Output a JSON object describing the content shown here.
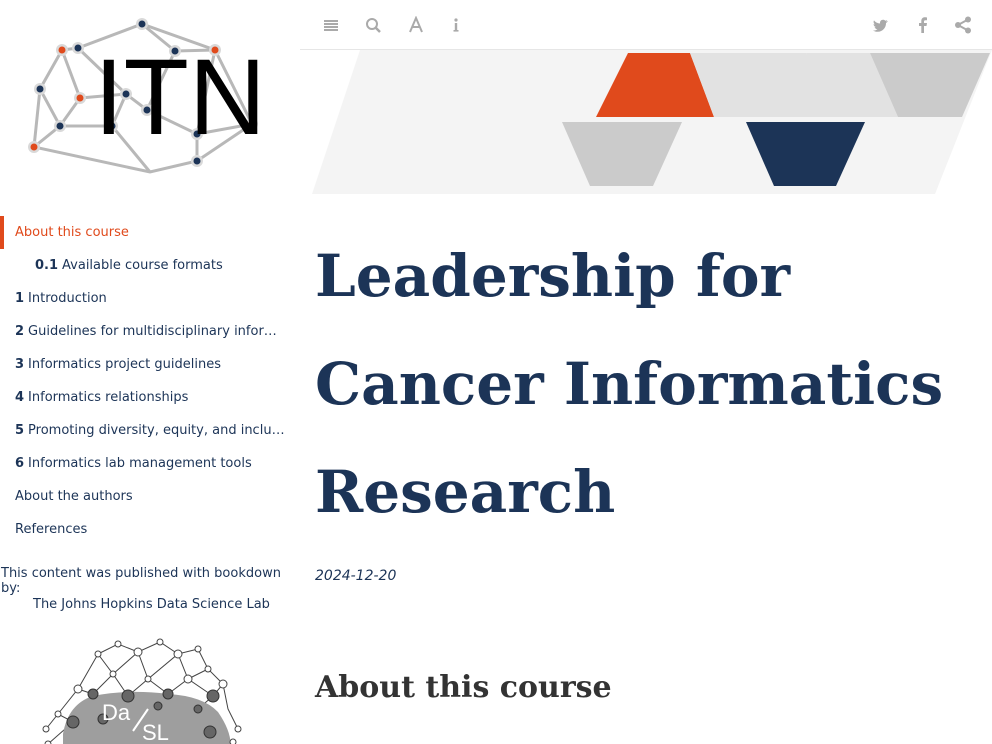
{
  "toolbar": {
    "icons": [
      "menu-icon",
      "search-icon",
      "font-icon",
      "info-icon",
      "twitter-icon",
      "facebook-icon",
      "share-icon"
    ]
  },
  "sidebar": {
    "items": [
      {
        "num": "",
        "label": "About this course",
        "active": true
      },
      {
        "num": "0.1",
        "label": "Available course formats"
      },
      {
        "num": "1",
        "label": "Introduction"
      },
      {
        "num": "2",
        "label": "Guidelines for multidisciplinary infor…"
      },
      {
        "num": "3",
        "label": "Informatics project guidelines"
      },
      {
        "num": "4",
        "label": "Informatics relationships"
      },
      {
        "num": "5",
        "label": "Promoting diversity, equity, and inclus…"
      },
      {
        "num": "6",
        "label": "Informatics lab management tools"
      },
      {
        "num": "",
        "label": "About the authors"
      },
      {
        "num": "",
        "label": "References"
      }
    ],
    "published_text": "This content was published with bookdown by:",
    "publisher_link": "The Johns Hopkins Data Science Lab"
  },
  "logo": {
    "text": "ITN"
  },
  "dasl_logo": {
    "text_top": "Da",
    "text_bottom": "SL"
  },
  "main": {
    "title": "Leadership for Cancer Informatics Research",
    "date": "2024-12-20",
    "section_heading": "About this course"
  },
  "colors": {
    "accent": "#e04a1c",
    "navy": "#1c3457",
    "gray": "#cccccc"
  }
}
